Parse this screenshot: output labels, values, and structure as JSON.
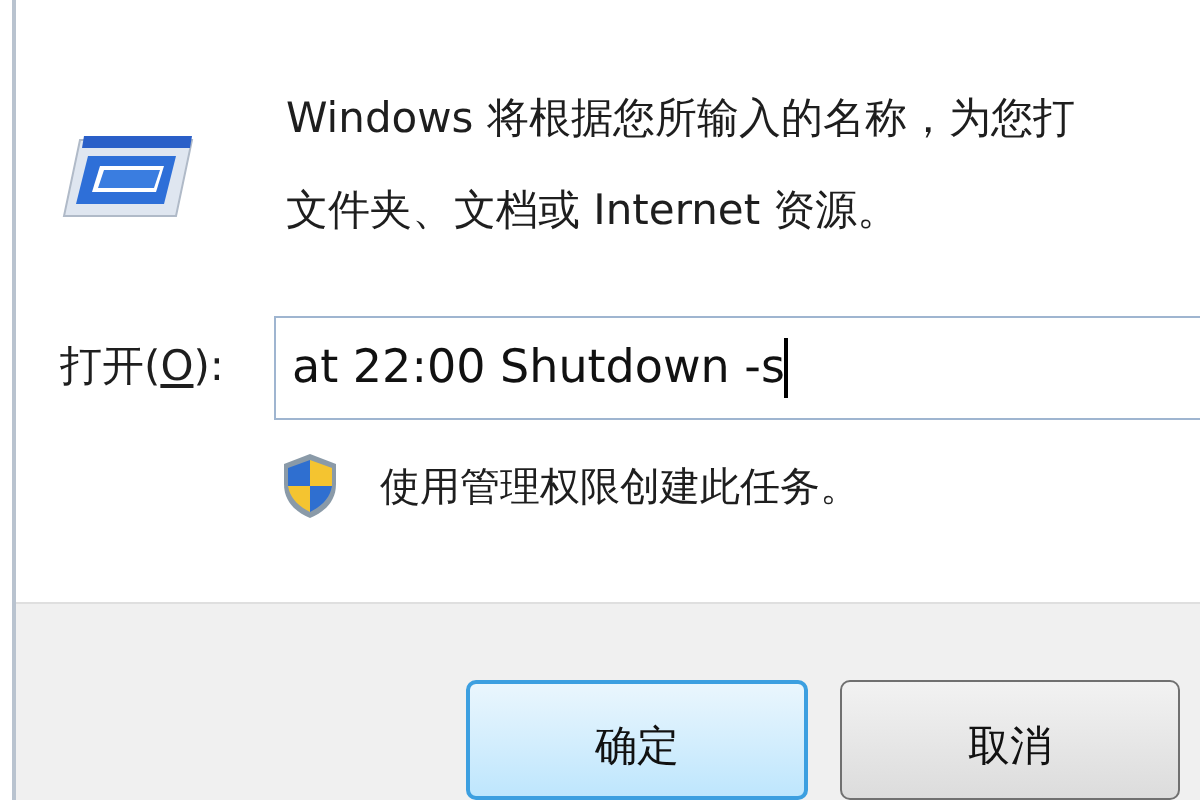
{
  "description": [
    "Windows 将根据您所输入的名称，为您打",
    "文件夹、文档或 Internet 资源。"
  ],
  "open_field": {
    "label_prefix": "打开(",
    "access_key": "O",
    "label_suffix": "):",
    "value": "at 22:00 Shutdown -s",
    "focused": true
  },
  "admin_note": "使用管理权限创建此任务。",
  "buttons": [
    {
      "label": "确定",
      "selected": true
    },
    {
      "label": "取消",
      "selected": false
    }
  ]
}
